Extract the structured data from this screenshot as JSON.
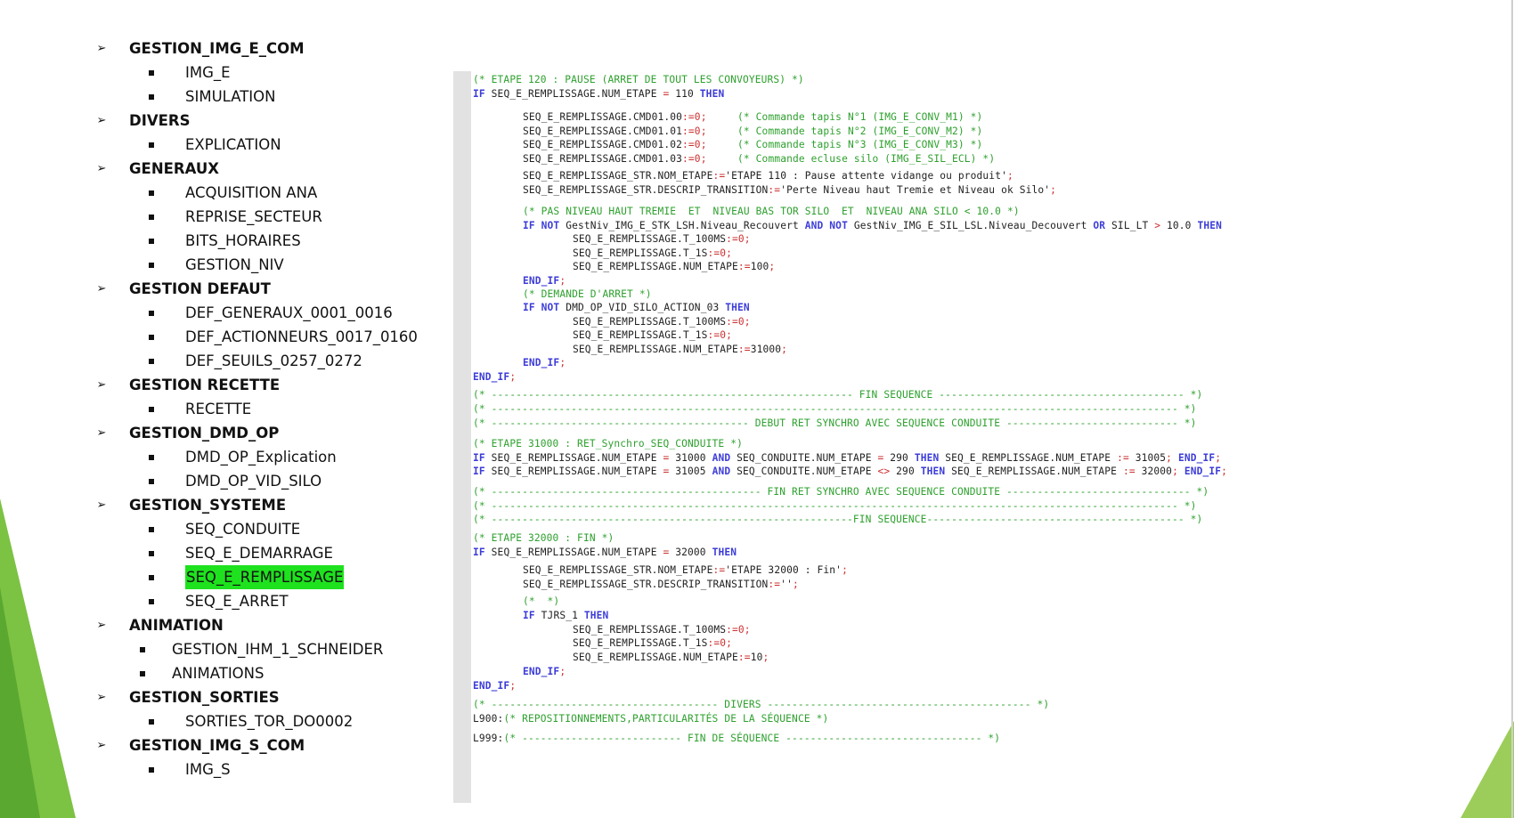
{
  "tree": [
    {
      "type": "group",
      "label": "GESTION_IMG_E_COM"
    },
    {
      "type": "item",
      "label": "IMG_E"
    },
    {
      "type": "item",
      "label": "SIMULATION"
    },
    {
      "type": "group",
      "label": "DIVERS"
    },
    {
      "type": "item",
      "label": "EXPLICATION"
    },
    {
      "type": "group",
      "label": "GENERAUX"
    },
    {
      "type": "item",
      "label": "ACQUISITION ANA"
    },
    {
      "type": "item",
      "label": "REPRISE_SECTEUR"
    },
    {
      "type": "item",
      "label": "BITS_HORAIRES"
    },
    {
      "type": "item",
      "label": "GESTION_NIV"
    },
    {
      "type": "group",
      "label": "GESTION DEFAUT"
    },
    {
      "type": "item",
      "label": "DEF_GENERAUX_0001_0016"
    },
    {
      "type": "item",
      "label": "DEF_ACTIONNEURS_0017_0160"
    },
    {
      "type": "item",
      "label": "DEF_SEUILS_0257_0272"
    },
    {
      "type": "group",
      "label": "GESTION RECETTE"
    },
    {
      "type": "item",
      "label": "RECETTE"
    },
    {
      "type": "group",
      "label": "GESTION_DMD_OP"
    },
    {
      "type": "item",
      "label": "DMD_OP_Explication"
    },
    {
      "type": "item",
      "label": "DMD_OP_VID_SILO"
    },
    {
      "type": "group",
      "label": "GESTION_SYSTEME"
    },
    {
      "type": "item",
      "label": "SEQ_CONDUITE"
    },
    {
      "type": "item",
      "label": "SEQ_E_DEMARRAGE"
    },
    {
      "type": "item",
      "label": "SEQ_E_REMPLISSAGE",
      "active": true
    },
    {
      "type": "item",
      "label": "SEQ_E_ARRET"
    },
    {
      "type": "group",
      "label": "ANIMATION"
    },
    {
      "type": "item",
      "label": "GESTION_IHM_1_SCHNEIDER",
      "shift": true
    },
    {
      "type": "item",
      "label": "ANIMATIONS",
      "shift": true
    },
    {
      "type": "group",
      "label": "GESTION_SORTIES"
    },
    {
      "type": "item",
      "label": "SORTIES_TOR_DO0002"
    },
    {
      "type": "group",
      "label": "GESTION_IMG_S_COM"
    },
    {
      "type": "item",
      "label": "IMG_S"
    }
  ],
  "code_lines": [
    {
      "indent": 0,
      "tokens": [
        [
          "c",
          "(* ETAPE 120 : PAUSE (ARRET DE TOUT LES CONVOYEURS) *)"
        ]
      ]
    },
    {
      "indent": 0,
      "tokens": [
        [
          "k",
          "IF"
        ],
        [
          "p",
          " SEQ_E_REMPLISSAGE.NUM_ETAPE "
        ],
        [
          "o",
          "="
        ],
        [
          "p",
          " 110 "
        ],
        [
          "k",
          "THEN"
        ]
      ]
    },
    {
      "indent": 0,
      "tokens": [
        [
          "p",
          ""
        ]
      ]
    },
    {
      "indent": 8,
      "tokens": [
        [
          "p",
          "SEQ_E_REMPLISSAGE.CMD01.00"
        ],
        [
          "o",
          ":=0;"
        ],
        [
          "p",
          "     "
        ],
        [
          "c",
          "(* Commande tapis N°1 (IMG_E_CONV_M1) *)"
        ]
      ]
    },
    {
      "indent": 8,
      "tokens": [
        [
          "p",
          "SEQ_E_REMPLISSAGE.CMD01.01"
        ],
        [
          "o",
          ":=0;"
        ],
        [
          "p",
          "     "
        ],
        [
          "c",
          "(* Commande tapis N°2 (IMG_E_CONV_M2) *)"
        ]
      ]
    },
    {
      "indent": 8,
      "tokens": [
        [
          "p",
          "SEQ_E_REMPLISSAGE.CMD01.02"
        ],
        [
          "o",
          ":=0;"
        ],
        [
          "p",
          "     "
        ],
        [
          "c",
          "(* Commande tapis N°3 (IMG_E_CONV_M3) *)"
        ]
      ]
    },
    {
      "indent": 8,
      "tokens": [
        [
          "p",
          "SEQ_E_REMPLISSAGE.CMD01.03"
        ],
        [
          "o",
          ":=0;"
        ],
        [
          "p",
          "     "
        ],
        [
          "c",
          "(* Commande ecluse silo (IMG_E_SIL_ECL) *)"
        ]
      ]
    },
    {
      "indent": 8,
      "tokens": [
        [
          "p",
          "SEQ_E_REMPLISSAGE_STR.NOM_ETAPE"
        ],
        [
          "o",
          ":="
        ],
        [
          "p",
          "'ETAPE 110 : Pause attente vidange ou produit'"
        ],
        [
          "o",
          ";"
        ]
      ]
    },
    {
      "indent": 8,
      "tokens": [
        [
          "p",
          "SEQ_E_REMPLISSAGE_STR.DESCRIP_TRANSITION"
        ],
        [
          "o",
          ":="
        ],
        [
          "p",
          "'Perte Niveau haut Tremie et Niveau ok Silo'"
        ],
        [
          "o",
          ";"
        ]
      ]
    },
    {
      "indent": 8,
      "tokens": [
        [
          "c",
          "(* PAS NIVEAU HAUT TREMIE  ET  NIVEAU BAS TOR SILO  ET  NIVEAU ANA SILO < 10.0 *)"
        ]
      ]
    },
    {
      "indent": 8,
      "tokens": [
        [
          "k",
          "IF NOT"
        ],
        [
          "p",
          " GestNiv_IMG_E_STK_LSH.Niveau_Recouvert "
        ],
        [
          "k",
          "AND NOT"
        ],
        [
          "p",
          " GestNiv_IMG_E_SIL_LSL.Niveau_Decouvert "
        ],
        [
          "k",
          "OR"
        ],
        [
          "p",
          " SIL_LT "
        ],
        [
          "o",
          ">"
        ],
        [
          "p",
          " 10.0 "
        ],
        [
          "k",
          "THEN"
        ]
      ]
    },
    {
      "indent": 16,
      "tokens": [
        [
          "p",
          "SEQ_E_REMPLISSAGE.T_100MS"
        ],
        [
          "o",
          ":=0;"
        ]
      ]
    },
    {
      "indent": 16,
      "tokens": [
        [
          "p",
          "SEQ_E_REMPLISSAGE.T_1S"
        ],
        [
          "o",
          ":=0;"
        ]
      ]
    },
    {
      "indent": 16,
      "tokens": [
        [
          "p",
          "SEQ_E_REMPLISSAGE.NUM_ETAPE"
        ],
        [
          "o",
          ":="
        ],
        [
          "p",
          "100"
        ],
        [
          "o",
          ";"
        ]
      ]
    },
    {
      "indent": 8,
      "tokens": [
        [
          "k",
          "END_IF"
        ],
        [
          "o",
          ";"
        ]
      ]
    },
    {
      "indent": 8,
      "tokens": [
        [
          "c",
          "(* DEMANDE D'ARRET *)"
        ]
      ]
    },
    {
      "indent": 8,
      "tokens": [
        [
          "k",
          "IF NOT"
        ],
        [
          "p",
          " DMD_OP_VID_SILO_ACTION_03 "
        ],
        [
          "k",
          "THEN"
        ]
      ]
    },
    {
      "indent": 16,
      "tokens": [
        [
          "p",
          "SEQ_E_REMPLISSAGE.T_100MS"
        ],
        [
          "o",
          ":=0;"
        ]
      ]
    },
    {
      "indent": 16,
      "tokens": [
        [
          "p",
          "SEQ_E_REMPLISSAGE.T_1S"
        ],
        [
          "o",
          ":=0;"
        ]
      ]
    },
    {
      "indent": 16,
      "tokens": [
        [
          "p",
          "SEQ_E_REMPLISSAGE.NUM_ETAPE"
        ],
        [
          "o",
          ":="
        ],
        [
          "p",
          "31000"
        ],
        [
          "o",
          ";"
        ]
      ]
    },
    {
      "indent": 8,
      "tokens": [
        [
          "k",
          "END_IF"
        ],
        [
          "o",
          ";"
        ]
      ]
    },
    {
      "indent": 0,
      "tokens": [
        [
          "k",
          "END_IF"
        ],
        [
          "o",
          ";"
        ]
      ]
    },
    {
      "indent": 0,
      "tokens": [
        [
          "c",
          "(* ----------------------------------------------------------- FIN SEQUENCE ---------------------------------------- *)"
        ]
      ]
    },
    {
      "indent": 0,
      "tokens": [
        [
          "c",
          "(* ---------------------------------------------------------------------------------------------------------------- *)"
        ]
      ]
    },
    {
      "indent": 0,
      "tokens": [
        [
          "c",
          "(* ------------------------------------------ DEBUT RET SYNCHRO AVEC SEQUENCE CONDUITE ---------------------------- *)"
        ]
      ]
    },
    {
      "indent": 0,
      "tokens": [
        [
          "c",
          "(* ETAPE 31000 : RET_Synchro_SEQ_CONDUITE *)"
        ]
      ]
    },
    {
      "indent": 0,
      "tokens": [
        [
          "k",
          "IF"
        ],
        [
          "p",
          " SEQ_E_REMPLISSAGE.NUM_ETAPE "
        ],
        [
          "o",
          "="
        ],
        [
          "p",
          " 31000 "
        ],
        [
          "k",
          "AND"
        ],
        [
          "p",
          " SEQ_CONDUITE.NUM_ETAPE "
        ],
        [
          "o",
          "="
        ],
        [
          "p",
          " 290 "
        ],
        [
          "k",
          "THEN"
        ],
        [
          "p",
          " SEQ_E_REMPLISSAGE.NUM_ETAPE "
        ],
        [
          "o",
          ":="
        ],
        [
          "p",
          " 31005"
        ],
        [
          "o",
          ";"
        ],
        [
          "p",
          " "
        ],
        [
          "k",
          "END_IF"
        ],
        [
          "o",
          ";"
        ]
      ]
    },
    {
      "indent": 0,
      "tokens": [
        [
          "k",
          "IF"
        ],
        [
          "p",
          " SEQ_E_REMPLISSAGE.NUM_ETAPE "
        ],
        [
          "o",
          "="
        ],
        [
          "p",
          " 31005 "
        ],
        [
          "k",
          "AND"
        ],
        [
          "p",
          " SEQ_CONDUITE.NUM_ETAPE "
        ],
        [
          "o",
          "<>"
        ],
        [
          "p",
          " 290 "
        ],
        [
          "k",
          "THEN"
        ],
        [
          "p",
          " SEQ_E_REMPLISSAGE.NUM_ETAPE "
        ],
        [
          "o",
          ":="
        ],
        [
          "p",
          " 32000"
        ],
        [
          "o",
          ";"
        ],
        [
          "p",
          " "
        ],
        [
          "k",
          "END_IF"
        ],
        [
          "o",
          ";"
        ]
      ]
    },
    {
      "indent": 0,
      "tokens": [
        [
          "c",
          "(* -------------------------------------------- FIN RET SYNCHRO AVEC SEQUENCE CONDUITE ------------------------------ *)"
        ]
      ]
    },
    {
      "indent": 0,
      "tokens": [
        [
          "c",
          "(* ---------------------------------------------------------------------------------------------------------------- *)"
        ]
      ]
    },
    {
      "indent": 0,
      "tokens": [
        [
          "c",
          "(* -----------------------------------------------------------FIN SEQUENCE------------------------------------------ *)"
        ]
      ]
    },
    {
      "indent": 0,
      "tokens": [
        [
          "c",
          "(* ETAPE 32000 : FIN *)"
        ]
      ]
    },
    {
      "indent": 0,
      "tokens": [
        [
          "k",
          "IF"
        ],
        [
          "p",
          " SEQ_E_REMPLISSAGE.NUM_ETAPE "
        ],
        [
          "o",
          "="
        ],
        [
          "p",
          " 32000 "
        ],
        [
          "k",
          "THEN"
        ]
      ]
    },
    {
      "indent": 8,
      "tokens": [
        [
          "p",
          "SEQ_E_REMPLISSAGE_STR.NOM_ETAPE"
        ],
        [
          "o",
          ":="
        ],
        [
          "p",
          "'ETAPE 32000 : Fin'"
        ],
        [
          "o",
          ";"
        ]
      ]
    },
    {
      "indent": 8,
      "tokens": [
        [
          "p",
          "SEQ_E_REMPLISSAGE_STR.DESCRIP_TRANSITION"
        ],
        [
          "o",
          ":="
        ],
        [
          "p",
          "''"
        ],
        [
          "o",
          ";"
        ]
      ]
    },
    {
      "indent": 8,
      "tokens": [
        [
          "c",
          "(*  *)"
        ]
      ]
    },
    {
      "indent": 8,
      "tokens": [
        [
          "k",
          "IF"
        ],
        [
          "p",
          " TJRS_1 "
        ],
        [
          "k",
          "THEN"
        ]
      ]
    },
    {
      "indent": 16,
      "tokens": [
        [
          "p",
          "SEQ_E_REMPLISSAGE.T_100MS"
        ],
        [
          "o",
          ":=0;"
        ]
      ]
    },
    {
      "indent": 16,
      "tokens": [
        [
          "p",
          "SEQ_E_REMPLISSAGE.T_1S"
        ],
        [
          "o",
          ":=0;"
        ]
      ]
    },
    {
      "indent": 16,
      "tokens": [
        [
          "p",
          "SEQ_E_REMPLISSAGE.NUM_ETAPE"
        ],
        [
          "o",
          ":="
        ],
        [
          "p",
          "10"
        ],
        [
          "o",
          ";"
        ]
      ]
    },
    {
      "indent": 8,
      "tokens": [
        [
          "k",
          "END_IF"
        ],
        [
          "o",
          ";"
        ]
      ]
    },
    {
      "indent": 0,
      "tokens": [
        [
          "k",
          "END_IF"
        ],
        [
          "o",
          ";"
        ]
      ]
    },
    {
      "indent": 0,
      "tokens": [
        [
          "c",
          "(* ------------------------------------- DIVERS ------------------------------------------- *)"
        ]
      ]
    },
    {
      "indent": 0,
      "tokens": [
        [
          "p",
          "L900:"
        ],
        [
          "c",
          "(* REPOSITIONNEMENTS,PARTICULARITÉS DE LA SÉQUENCE *)"
        ]
      ]
    },
    {
      "indent": 0,
      "tokens": [
        [
          "p",
          ""
        ]
      ]
    },
    {
      "indent": 0,
      "tokens": [
        [
          "p",
          "L999:"
        ],
        [
          "c",
          "(* -------------------------- FIN DE SÉQUENCE -------------------------------- *)"
        ]
      ]
    }
  ],
  "colors": {
    "accent_green": "#1ee21e",
    "comment": "#2ea02e",
    "keyword": "#3d3dd8",
    "operator": "#cc3030"
  }
}
